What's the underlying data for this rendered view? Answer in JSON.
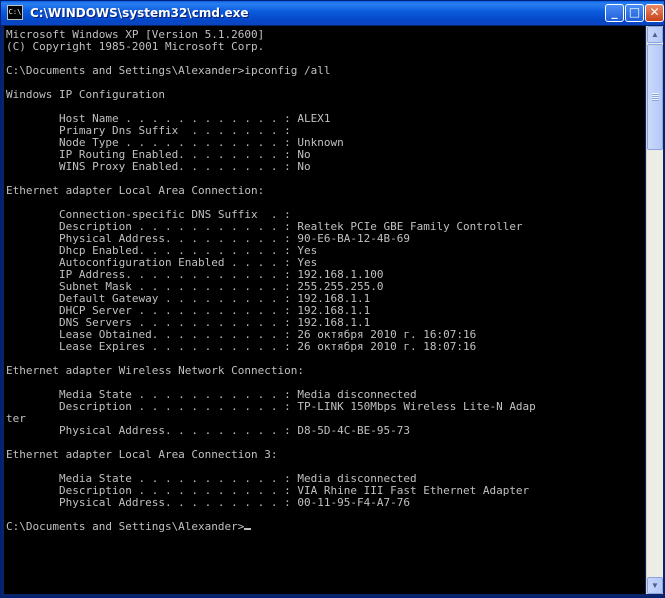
{
  "window": {
    "title": "C:\\WINDOWS\\system32\\cmd.exe",
    "icon": "cmd-icon",
    "buttons": {
      "minimize": "_",
      "maximize": "□",
      "close": "✕"
    }
  },
  "console": {
    "lines": [
      "Microsoft Windows XP [Version 5.1.2600]",
      "(C) Copyright 1985-2001 Microsoft Corp.",
      "",
      "C:\\Documents and Settings\\Alexander>ipconfig /all",
      "",
      "Windows IP Configuration",
      "",
      "        Host Name . . . . . . . . . . . . : ALEX1",
      "        Primary Dns Suffix  . . . . . . . :",
      "        Node Type . . . . . . . . . . . . : Unknown",
      "        IP Routing Enabled. . . . . . . . : No",
      "        WINS Proxy Enabled. . . . . . . . : No",
      "",
      "Ethernet adapter Local Area Connection:",
      "",
      "        Connection-specific DNS Suffix  . :",
      "        Description . . . . . . . . . . . : Realtek PCIe GBE Family Controller",
      "        Physical Address. . . . . . . . . : 90-E6-BA-12-4B-69",
      "        Dhcp Enabled. . . . . . . . . . . : Yes",
      "        Autoconfiguration Enabled . . . . : Yes",
      "        IP Address. . . . . . . . . . . . : 192.168.1.100",
      "        Subnet Mask . . . . . . . . . . . : 255.255.255.0",
      "        Default Gateway . . . . . . . . . : 192.168.1.1",
      "        DHCP Server . . . . . . . . . . . : 192.168.1.1",
      "        DNS Servers . . . . . . . . . . . : 192.168.1.1",
      "        Lease Obtained. . . . . . . . . . : 26 октября 2010 г. 16:07:16",
      "        Lease Expires . . . . . . . . . . : 26 октября 2010 г. 18:07:16",
      "",
      "Ethernet adapter Wireless Network Connection:",
      "",
      "        Media State . . . . . . . . . . . : Media disconnected",
      "        Description . . . . . . . . . . . : TP-LINK 150Mbps Wireless Lite-N Adap",
      "ter",
      "        Physical Address. . . . . . . . . : D8-5D-4C-BE-95-73",
      "",
      "Ethernet adapter Local Area Connection 3:",
      "",
      "        Media State . . . . . . . . . . . : Media disconnected",
      "        Description . . . . . . . . . . . : VIA Rhine III Fast Ethernet Adapter",
      "        Physical Address. . . . . . . . . : 00-11-95-F4-A7-76",
      "",
      "C:\\Documents and Settings\\Alexander>"
    ]
  },
  "scrollbar": {
    "up_arrow": "▲",
    "down_arrow": "▼"
  },
  "colors": {
    "console_background": "#000000",
    "console_text": "#c0c0c0",
    "titlebar": "#0a5bdc"
  }
}
